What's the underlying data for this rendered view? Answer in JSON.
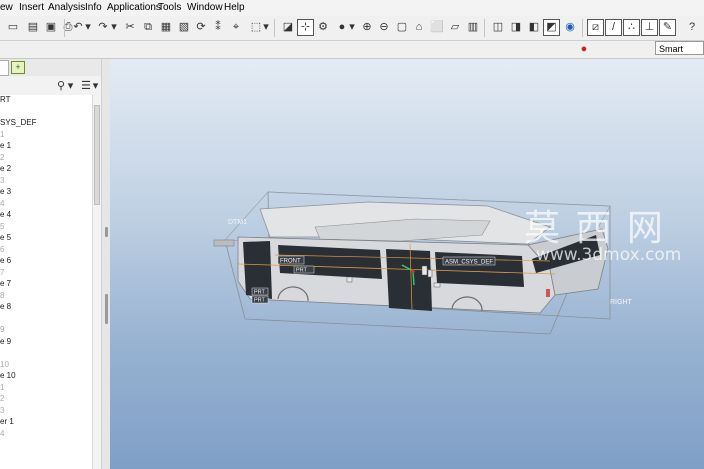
{
  "menu": [
    "ew",
    "Insert",
    "Analysis",
    "Info",
    "Applications",
    "Tools",
    "Window",
    "Help"
  ],
  "search": {
    "value": "Smart"
  },
  "tree_items": [
    "RT",
    "",
    "SYS_DEF",
    "1",
    "e 1",
    "2",
    "e 2",
    "3",
    "e 3",
    "4",
    "e 4",
    "5",
    "e 5",
    "6",
    "e 6",
    "7",
    "e 7",
    "8",
    "e 8",
    "",
    "9",
    "e 9",
    "",
    "10",
    "e 10",
    "1",
    "2",
    "3",
    "er 1",
    "4"
  ],
  "model_labels": {
    "front_datum": "DTM1",
    "plane_top": "FRONT",
    "plane_right": "RIGHT",
    "csys_main": "ASM_CSYS_DEF",
    "part_a": "PRT",
    "part_b": "PRT",
    "part_c": "PRT"
  },
  "watermark": {
    "title": "莫 西 网",
    "url": "www.3dmox.com"
  },
  "colors": {
    "viewport_top": "#e4ebf4",
    "viewport_bottom": "#7f9fc6",
    "model_body": "#d7d9dc",
    "window_dark": "#2a2f36",
    "datum_orange": "#e09a3a",
    "csys_green": "#2ad06a",
    "highlight_red": "#cc3333"
  },
  "icons": [
    "new-icon",
    "open-icon",
    "save-icon",
    "print-icon",
    "undo-icon",
    "redo-icon",
    "cut-icon",
    "copy-icon",
    "paste-icon",
    "regenerate-icon",
    "find-icon",
    "select-box-icon",
    "repaint-icon",
    "spin-center-icon",
    "orient-icon",
    "shading-icon",
    "zoom-in-icon",
    "zoom-out-icon",
    "refit-icon",
    "datum-plane-icon",
    "datum-axis-icon",
    "datum-point-icon",
    "csys-icon",
    "traffic-light-icon"
  ]
}
